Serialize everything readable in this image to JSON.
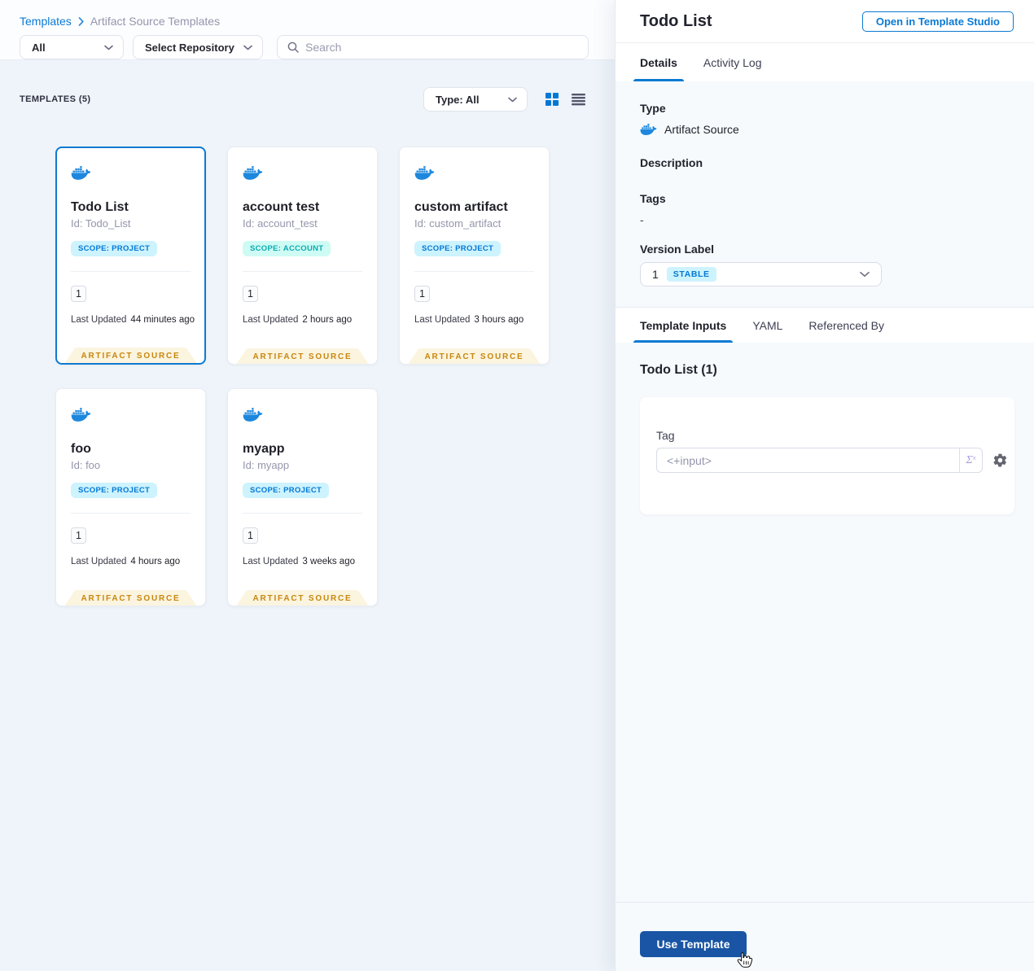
{
  "colors": {
    "primary_blue": "#0278d5",
    "use_button_blue": "#1955a4",
    "project_badge_bg": "#cdf3fe",
    "account_badge_bg": "#cefbf4",
    "account_badge_text": "#0cacb2",
    "ribbon_bg": "#fbf4df",
    "ribbon_text": "#c8870e",
    "left_body_bg": "#eef4f9",
    "drawer_bg": "#f6fafd"
  },
  "breadcrumb": {
    "link": "Templates",
    "separator": "›",
    "current": "Artifact Source Templates"
  },
  "filters": {
    "scope_dropdown": "All",
    "repo_dropdown": "Select Repository",
    "search_placeholder": "Search"
  },
  "grid_header": {
    "count_label": "TEMPLATES (5)",
    "type_dropdown": "Type: All"
  },
  "cards": [
    {
      "title": "Todo List",
      "id": "Id: Todo_List",
      "scope_badge": "SCOPE: PROJECT",
      "scope": "project",
      "version_count": "1",
      "updated_label": "Last Updated",
      "updated_value": "44 minutes ago",
      "ribbon": "ARTIFACT SOURCE",
      "selected": true
    },
    {
      "title": "account test",
      "id": "Id: account_test",
      "scope_badge": "SCOPE: ACCOUNT",
      "scope": "account",
      "version_count": "1",
      "updated_label": "Last Updated",
      "updated_value": "2 hours ago",
      "ribbon": "ARTIFACT SOURCE",
      "selected": false
    },
    {
      "title": "custom artifact",
      "id": "Id: custom_artifact",
      "scope_badge": "SCOPE: PROJECT",
      "scope": "project",
      "version_count": "1",
      "updated_label": "Last Updated",
      "updated_value": "3 hours ago",
      "ribbon": "ARTIFACT SOURCE",
      "selected": false
    },
    {
      "title": "foo",
      "id": "Id: foo",
      "scope_badge": "SCOPE: PROJECT",
      "scope": "project",
      "version_count": "1",
      "updated_label": "Last Updated",
      "updated_value": "4 hours ago",
      "ribbon": "ARTIFACT SOURCE",
      "selected": false
    },
    {
      "title": "myapp",
      "id": "Id: myapp",
      "scope_badge": "SCOPE: PROJECT",
      "scope": "project",
      "version_count": "1",
      "updated_label": "Last Updated",
      "updated_value": "3 weeks ago",
      "ribbon": "ARTIFACT SOURCE",
      "selected": false
    }
  ],
  "drawer": {
    "title": "Todo List",
    "open_button": "Open in Template Studio",
    "tabs_primary": [
      {
        "label": "Details",
        "active": true
      },
      {
        "label": "Activity Log",
        "active": false
      }
    ],
    "details": {
      "type_label": "Type",
      "type_value": "Artifact Source",
      "description_label": "Description",
      "tags_label": "Tags",
      "tags_value": "-",
      "version_label": "Version Label",
      "version_value": "1",
      "version_badge": "STABLE"
    },
    "tabs_secondary": [
      {
        "label": "Template Inputs",
        "active": true
      },
      {
        "label": "YAML",
        "active": false
      },
      {
        "label": "Referenced By",
        "active": false
      }
    ],
    "inputs": {
      "heading": "Todo List (1)",
      "field_label": "Tag",
      "field_value": "<+input>",
      "expression_icon": "Σ",
      "expression_sup": "x"
    },
    "footer": {
      "use_button": "Use Template"
    }
  }
}
